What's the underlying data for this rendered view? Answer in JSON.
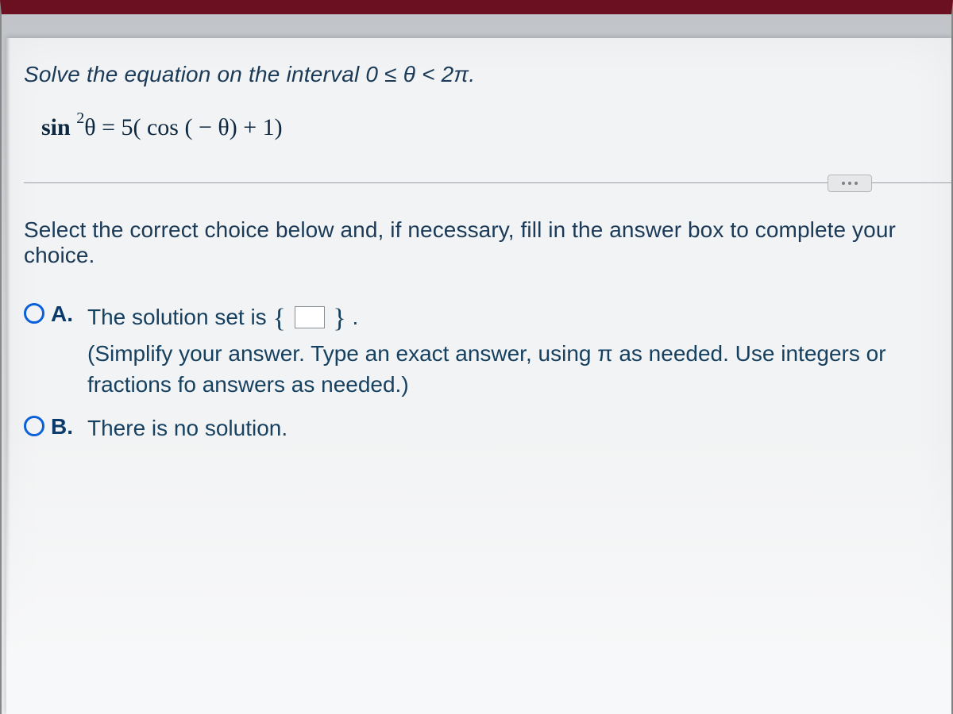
{
  "question": {
    "prompt": "Solve the equation on the interval 0 ≤ θ < 2π.",
    "equation_prefix": "sin",
    "equation_exponent": "2",
    "equation_variable": "θ",
    "equation_rhs": " = 5( cos ( − θ) + 1)"
  },
  "instruction": "Select the correct choice below and, if necessary, fill in the answer box to complete your choice.",
  "choices": {
    "a": {
      "label": "A.",
      "text_before": "The solution set is ",
      "text_after": ".",
      "hint": "(Simplify your answer. Type an exact answer, using π as needed. Use integers or fractions fo answers as needed.)"
    },
    "b": {
      "label": "B.",
      "text": "There is no solution."
    }
  }
}
